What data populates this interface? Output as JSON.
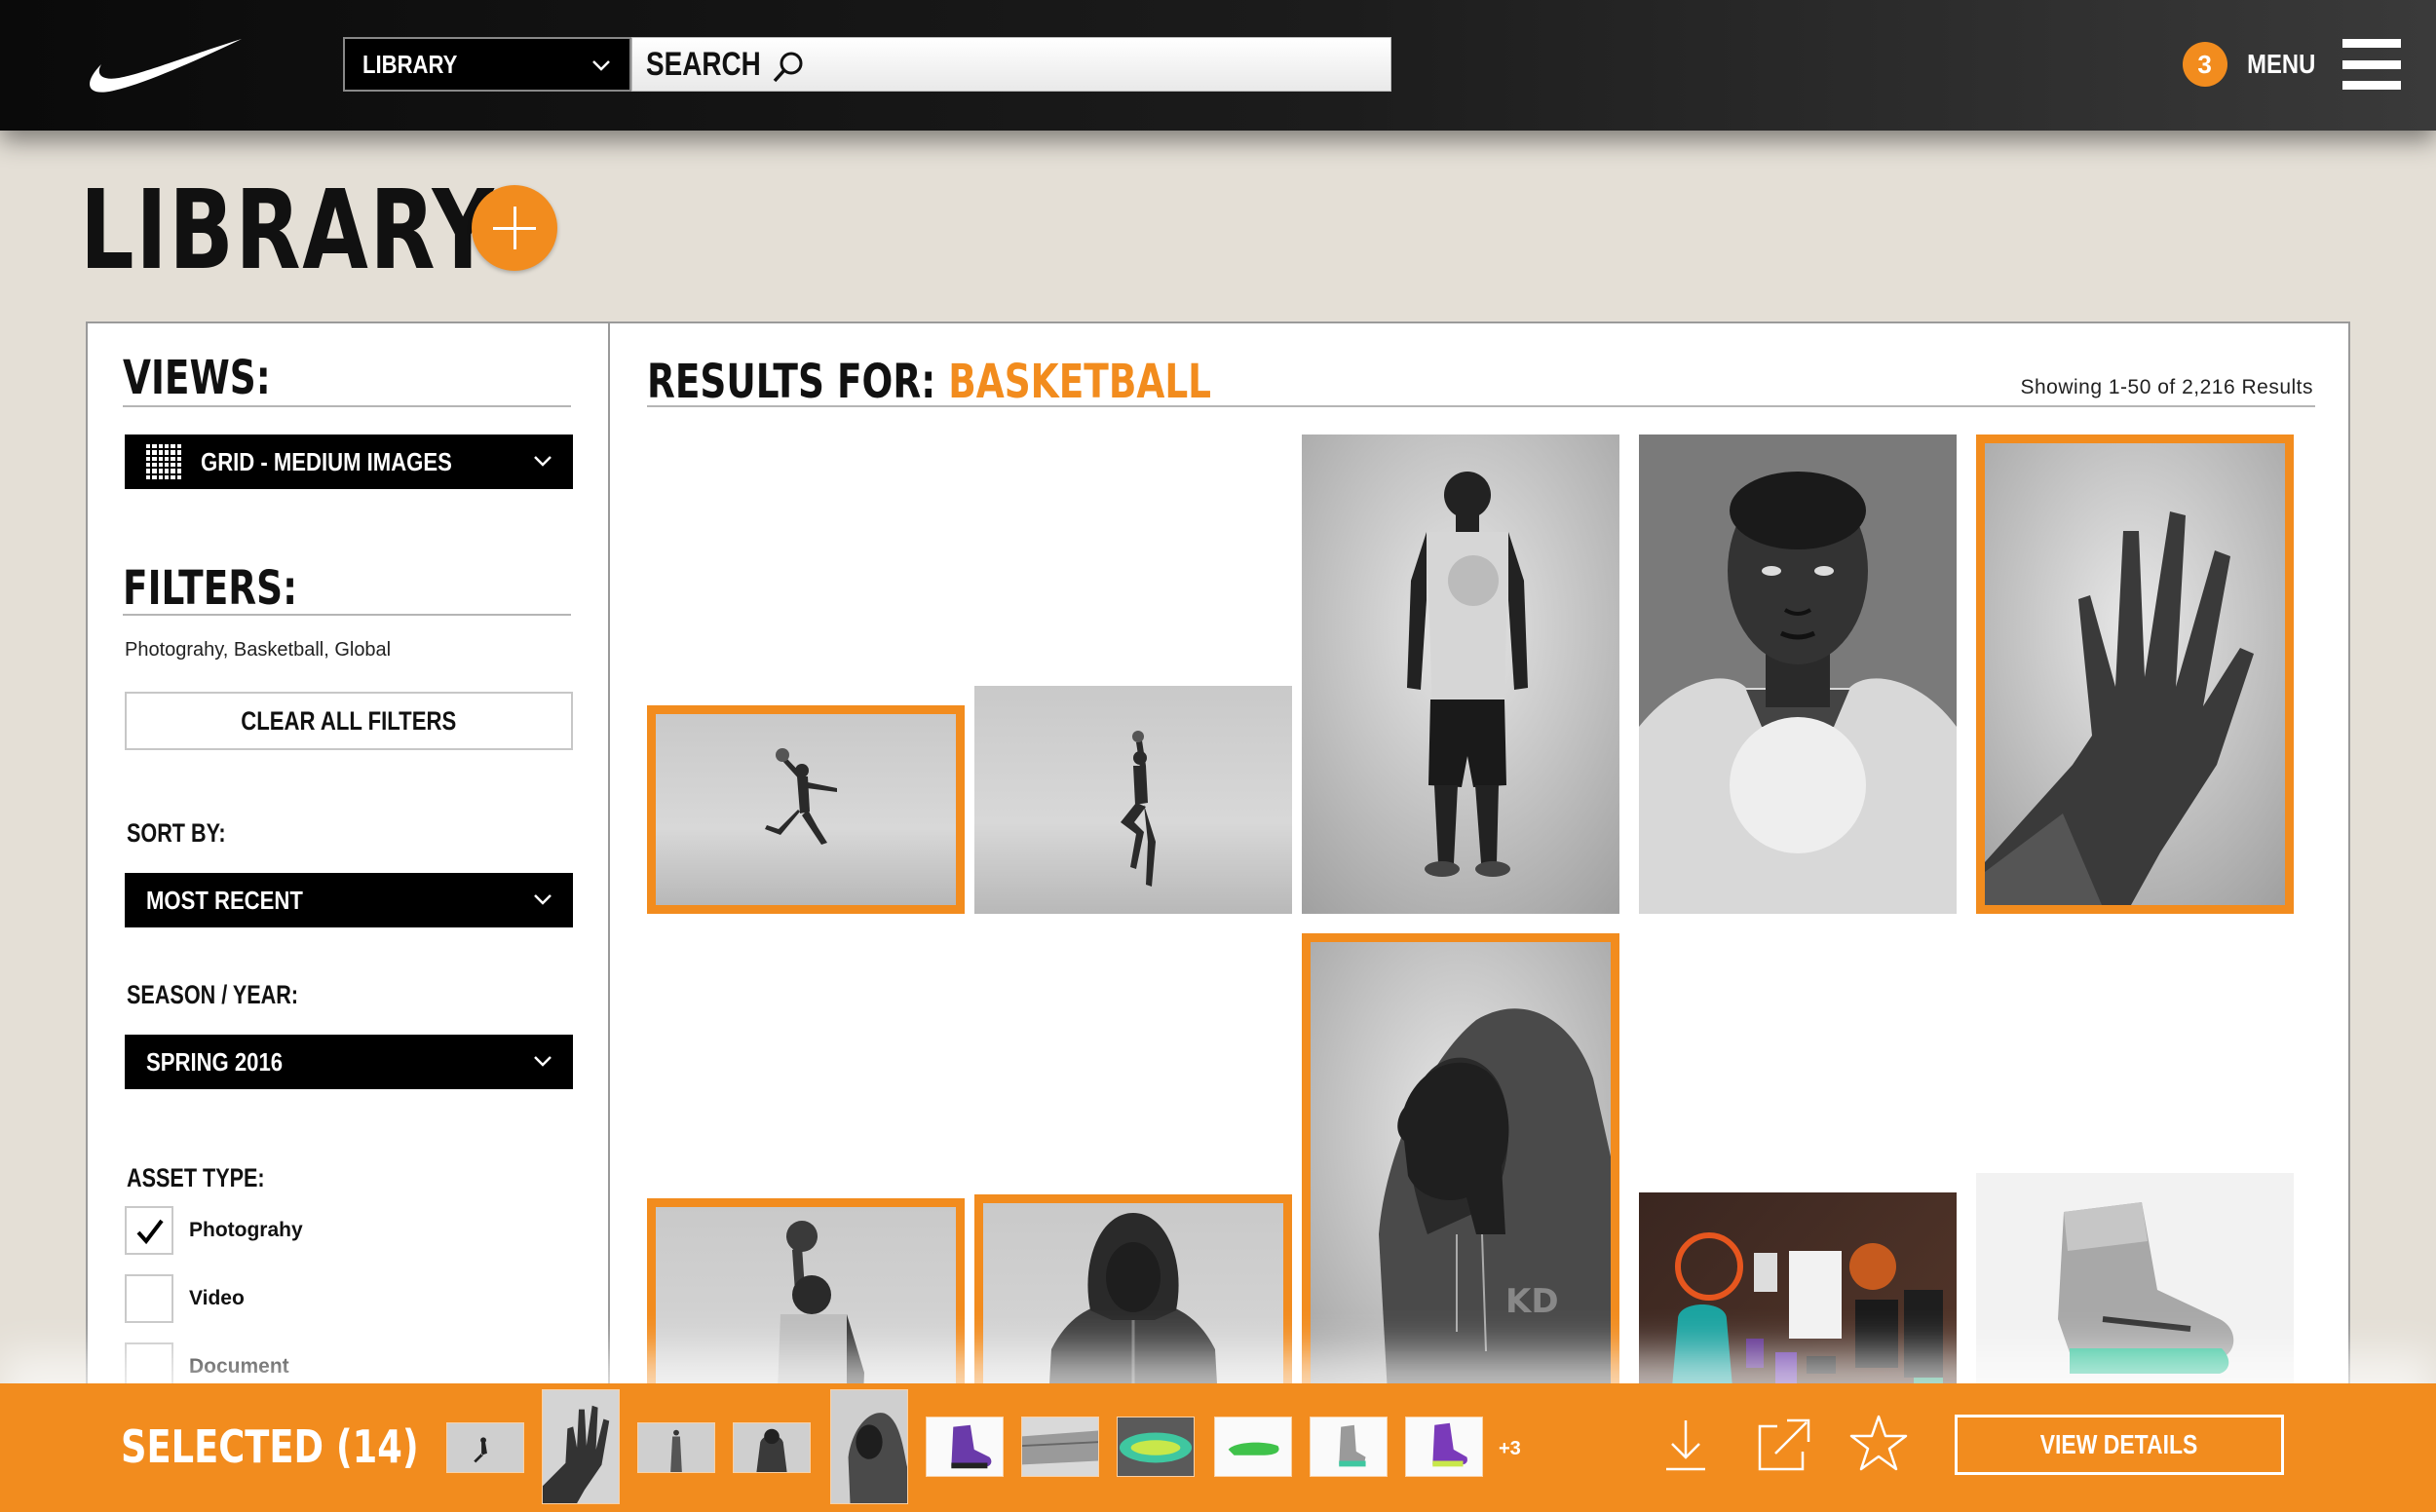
{
  "header": {
    "brand": "Nike",
    "library_select": "LIBRARY",
    "search_label": "SEARCH",
    "notification_count": "3",
    "menu_label": "MENU"
  },
  "page": {
    "title": "LIBRARY"
  },
  "sidebar": {
    "views_heading": "VIEWS:",
    "view_select": "GRID - MEDIUM IMAGES",
    "filters_heading": "FILTERS:",
    "active_filters": "Photograhy, Basketball, Global",
    "clear_filters": "CLEAR ALL FILTERS",
    "sort_label": "SORT BY:",
    "sort_value": "MOST RECENT",
    "season_label": "SEASON / YEAR:",
    "season_value": "SPRING 2016",
    "asset_type_label": "ASSET TYPE:",
    "asset_types": [
      {
        "label": "Photograhy",
        "checked": true
      },
      {
        "label": "Video",
        "checked": false
      },
      {
        "label": "Document",
        "checked": false
      }
    ]
  },
  "results": {
    "prefix": "RESULTS FOR: ",
    "query": "BASKETBALL",
    "count_text": "Showing 1-50 of 2,216 Results",
    "thumbnails": [
      {
        "subject": "player-leaping-layup",
        "selected": true
      },
      {
        "subject": "player-jump-shot",
        "selected": false
      },
      {
        "subject": "player-standing-full-body",
        "selected": false
      },
      {
        "subject": "player-portrait",
        "selected": false
      },
      {
        "subject": "hand-raised",
        "selected": true
      },
      {
        "subject": "player-hoodie-profile",
        "selected": true
      },
      {
        "subject": "player-shooting-ball",
        "selected": true
      },
      {
        "subject": "player-hoodie-front",
        "selected": true
      },
      {
        "subject": "gear-flatlay",
        "selected": false
      },
      {
        "subject": "high-top-sneaker",
        "selected": false
      }
    ]
  },
  "selection_bar": {
    "label": "SELECTED (14)",
    "more_count": "+3",
    "view_details": "VIEW DETAILS"
  },
  "colors": {
    "accent": "#f28c1e",
    "topbar": "#111111",
    "background": "#e4dfd6"
  }
}
